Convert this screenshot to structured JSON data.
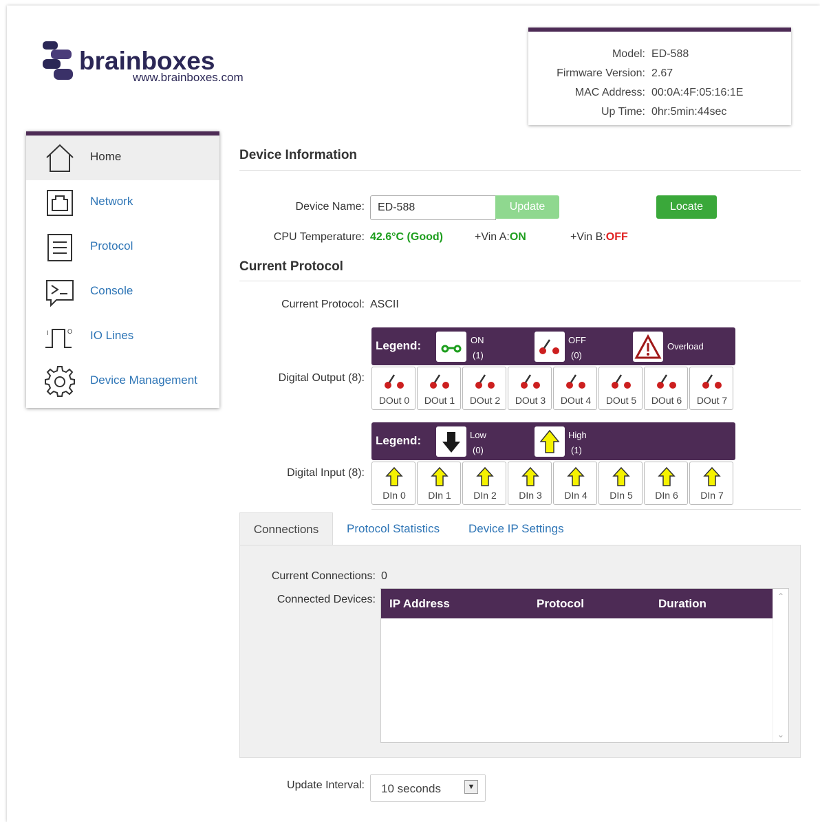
{
  "logo": {
    "wordmark": "brainboxes",
    "url": "www.brainboxes.com"
  },
  "device_info": {
    "model_label": "Model:",
    "model": "ED-588",
    "firmware_label": "Firmware Version:",
    "firmware": "2.67",
    "mac_label": "MAC Address:",
    "mac": "00:0A:4F:05:16:1E",
    "uptime_label": "Up Time:",
    "uptime": "0hr:5min:44sec"
  },
  "sidebar": {
    "items": [
      {
        "label": "Home",
        "icon": "home-icon"
      },
      {
        "label": "Network",
        "icon": "network-icon"
      },
      {
        "label": "Protocol",
        "icon": "protocol-icon"
      },
      {
        "label": "Console",
        "icon": "console-icon"
      },
      {
        "label": "IO Lines",
        "icon": "io-lines-icon"
      },
      {
        "label": "Device Management",
        "icon": "gear-icon"
      }
    ]
  },
  "device_section": {
    "title": "Device Information",
    "name_label": "Device Name:",
    "name_value": "ED-588",
    "update_button": "Update",
    "locate_button": "Locate",
    "cpu_label": "CPU Temperature:",
    "cpu_value": "42.6°C (Good)",
    "vin_a_label": "+Vin A:",
    "vin_a_value": "ON",
    "vin_b_label": "+Vin B:",
    "vin_b_value": "OFF"
  },
  "protocol_section": {
    "title": "Current Protocol",
    "protocol_label": "Current Protocol:",
    "protocol_value": "ASCII",
    "digital_output_label": "Digital Output (8):",
    "digital_input_label": "Digital Input (8):",
    "output_legend": {
      "title": "Legend:",
      "on_label": "ON",
      "on_value": "(1)",
      "off_label": "OFF",
      "off_value": "(0)",
      "overload_label": "Overload"
    },
    "input_legend": {
      "title": "Legend:",
      "low_label": "Low",
      "low_value": "(0)",
      "high_label": "High",
      "high_value": "(1)"
    },
    "outputs": [
      "DOut 0",
      "DOut 1",
      "DOut 2",
      "DOut 3",
      "DOut 4",
      "DOut 5",
      "DOut 6",
      "DOut 7"
    ],
    "inputs": [
      "DIn 0",
      "DIn 1",
      "DIn 2",
      "DIn 3",
      "DIn 4",
      "DIn 5",
      "DIn 6",
      "DIn 7"
    ]
  },
  "tabs": {
    "connections": "Connections",
    "protocol_statistics": "Protocol Statistics",
    "device_ip_settings": "Device IP Settings"
  },
  "connections": {
    "current_label": "Current Connections:",
    "current_value": "0",
    "devices_label": "Connected Devices:",
    "columns": [
      "IP Address",
      "Protocol",
      "Duration"
    ]
  },
  "update_interval": {
    "label": "Update Interval:",
    "value": "10 seconds"
  },
  "colors": {
    "accent": "#4d2b55",
    "link": "#2e75b6",
    "good": "#1e9e1e",
    "bad": "#e02020"
  }
}
